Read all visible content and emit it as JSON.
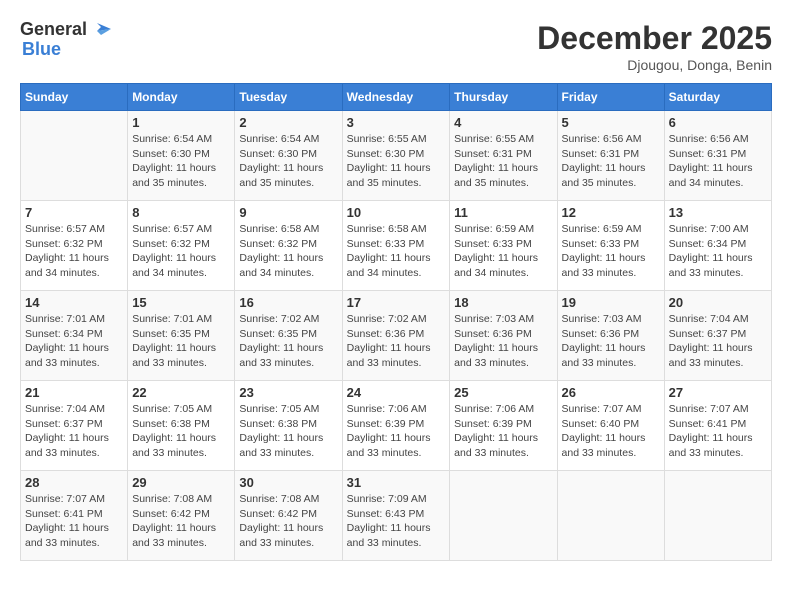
{
  "header": {
    "logo_general": "General",
    "logo_blue": "Blue",
    "month_title": "December 2025",
    "location": "Djougou, Donga, Benin"
  },
  "days_of_week": [
    "Sunday",
    "Monday",
    "Tuesday",
    "Wednesday",
    "Thursday",
    "Friday",
    "Saturday"
  ],
  "weeks": [
    [
      {
        "day": "",
        "sunrise": "",
        "sunset": "",
        "daylight": ""
      },
      {
        "day": "1",
        "sunrise": "Sunrise: 6:54 AM",
        "sunset": "Sunset: 6:30 PM",
        "daylight": "Daylight: 11 hours and 35 minutes."
      },
      {
        "day": "2",
        "sunrise": "Sunrise: 6:54 AM",
        "sunset": "Sunset: 6:30 PM",
        "daylight": "Daylight: 11 hours and 35 minutes."
      },
      {
        "day": "3",
        "sunrise": "Sunrise: 6:55 AM",
        "sunset": "Sunset: 6:30 PM",
        "daylight": "Daylight: 11 hours and 35 minutes."
      },
      {
        "day": "4",
        "sunrise": "Sunrise: 6:55 AM",
        "sunset": "Sunset: 6:31 PM",
        "daylight": "Daylight: 11 hours and 35 minutes."
      },
      {
        "day": "5",
        "sunrise": "Sunrise: 6:56 AM",
        "sunset": "Sunset: 6:31 PM",
        "daylight": "Daylight: 11 hours and 35 minutes."
      },
      {
        "day": "6",
        "sunrise": "Sunrise: 6:56 AM",
        "sunset": "Sunset: 6:31 PM",
        "daylight": "Daylight: 11 hours and 34 minutes."
      }
    ],
    [
      {
        "day": "7",
        "sunrise": "Sunrise: 6:57 AM",
        "sunset": "Sunset: 6:32 PM",
        "daylight": "Daylight: 11 hours and 34 minutes."
      },
      {
        "day": "8",
        "sunrise": "Sunrise: 6:57 AM",
        "sunset": "Sunset: 6:32 PM",
        "daylight": "Daylight: 11 hours and 34 minutes."
      },
      {
        "day": "9",
        "sunrise": "Sunrise: 6:58 AM",
        "sunset": "Sunset: 6:32 PM",
        "daylight": "Daylight: 11 hours and 34 minutes."
      },
      {
        "day": "10",
        "sunrise": "Sunrise: 6:58 AM",
        "sunset": "Sunset: 6:33 PM",
        "daylight": "Daylight: 11 hours and 34 minutes."
      },
      {
        "day": "11",
        "sunrise": "Sunrise: 6:59 AM",
        "sunset": "Sunset: 6:33 PM",
        "daylight": "Daylight: 11 hours and 34 minutes."
      },
      {
        "day": "12",
        "sunrise": "Sunrise: 6:59 AM",
        "sunset": "Sunset: 6:33 PM",
        "daylight": "Daylight: 11 hours and 33 minutes."
      },
      {
        "day": "13",
        "sunrise": "Sunrise: 7:00 AM",
        "sunset": "Sunset: 6:34 PM",
        "daylight": "Daylight: 11 hours and 33 minutes."
      }
    ],
    [
      {
        "day": "14",
        "sunrise": "Sunrise: 7:01 AM",
        "sunset": "Sunset: 6:34 PM",
        "daylight": "Daylight: 11 hours and 33 minutes."
      },
      {
        "day": "15",
        "sunrise": "Sunrise: 7:01 AM",
        "sunset": "Sunset: 6:35 PM",
        "daylight": "Daylight: 11 hours and 33 minutes."
      },
      {
        "day": "16",
        "sunrise": "Sunrise: 7:02 AM",
        "sunset": "Sunset: 6:35 PM",
        "daylight": "Daylight: 11 hours and 33 minutes."
      },
      {
        "day": "17",
        "sunrise": "Sunrise: 7:02 AM",
        "sunset": "Sunset: 6:36 PM",
        "daylight": "Daylight: 11 hours and 33 minutes."
      },
      {
        "day": "18",
        "sunrise": "Sunrise: 7:03 AM",
        "sunset": "Sunset: 6:36 PM",
        "daylight": "Daylight: 11 hours and 33 minutes."
      },
      {
        "day": "19",
        "sunrise": "Sunrise: 7:03 AM",
        "sunset": "Sunset: 6:36 PM",
        "daylight": "Daylight: 11 hours and 33 minutes."
      },
      {
        "day": "20",
        "sunrise": "Sunrise: 7:04 AM",
        "sunset": "Sunset: 6:37 PM",
        "daylight": "Daylight: 11 hours and 33 minutes."
      }
    ],
    [
      {
        "day": "21",
        "sunrise": "Sunrise: 7:04 AM",
        "sunset": "Sunset: 6:37 PM",
        "daylight": "Daylight: 11 hours and 33 minutes."
      },
      {
        "day": "22",
        "sunrise": "Sunrise: 7:05 AM",
        "sunset": "Sunset: 6:38 PM",
        "daylight": "Daylight: 11 hours and 33 minutes."
      },
      {
        "day": "23",
        "sunrise": "Sunrise: 7:05 AM",
        "sunset": "Sunset: 6:38 PM",
        "daylight": "Daylight: 11 hours and 33 minutes."
      },
      {
        "day": "24",
        "sunrise": "Sunrise: 7:06 AM",
        "sunset": "Sunset: 6:39 PM",
        "daylight": "Daylight: 11 hours and 33 minutes."
      },
      {
        "day": "25",
        "sunrise": "Sunrise: 7:06 AM",
        "sunset": "Sunset: 6:39 PM",
        "daylight": "Daylight: 11 hours and 33 minutes."
      },
      {
        "day": "26",
        "sunrise": "Sunrise: 7:07 AM",
        "sunset": "Sunset: 6:40 PM",
        "daylight": "Daylight: 11 hours and 33 minutes."
      },
      {
        "day": "27",
        "sunrise": "Sunrise: 7:07 AM",
        "sunset": "Sunset: 6:41 PM",
        "daylight": "Daylight: 11 hours and 33 minutes."
      }
    ],
    [
      {
        "day": "28",
        "sunrise": "Sunrise: 7:07 AM",
        "sunset": "Sunset: 6:41 PM",
        "daylight": "Daylight: 11 hours and 33 minutes."
      },
      {
        "day": "29",
        "sunrise": "Sunrise: 7:08 AM",
        "sunset": "Sunset: 6:42 PM",
        "daylight": "Daylight: 11 hours and 33 minutes."
      },
      {
        "day": "30",
        "sunrise": "Sunrise: 7:08 AM",
        "sunset": "Sunset: 6:42 PM",
        "daylight": "Daylight: 11 hours and 33 minutes."
      },
      {
        "day": "31",
        "sunrise": "Sunrise: 7:09 AM",
        "sunset": "Sunset: 6:43 PM",
        "daylight": "Daylight: 11 hours and 33 minutes."
      },
      {
        "day": "",
        "sunrise": "",
        "sunset": "",
        "daylight": ""
      },
      {
        "day": "",
        "sunrise": "",
        "sunset": "",
        "daylight": ""
      },
      {
        "day": "",
        "sunrise": "",
        "sunset": "",
        "daylight": ""
      }
    ]
  ]
}
